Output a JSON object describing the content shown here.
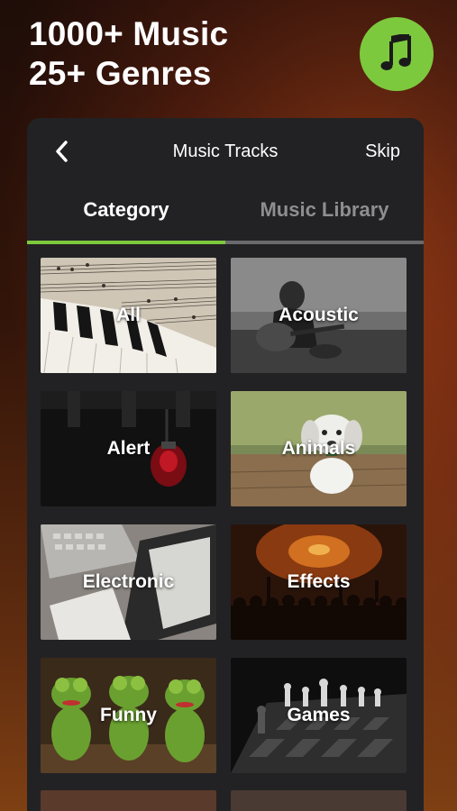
{
  "headline": {
    "line1": "1000+ Music",
    "line2": "25+ Genres"
  },
  "badge": {
    "icon": "music-note-icon",
    "color": "#7dc93e"
  },
  "header": {
    "title": "Music Tracks",
    "skip_label": "Skip",
    "back_icon": "chevron-left-icon"
  },
  "tabs": [
    {
      "label": "Category",
      "active": true
    },
    {
      "label": "Music Library",
      "active": false
    }
  ],
  "accent": "#7dc93e",
  "categories": [
    {
      "label": "All"
    },
    {
      "label": "Acoustic"
    },
    {
      "label": "Alert"
    },
    {
      "label": "Animals"
    },
    {
      "label": "Electronic"
    },
    {
      "label": "Effects"
    },
    {
      "label": "Funny"
    },
    {
      "label": "Games"
    }
  ]
}
